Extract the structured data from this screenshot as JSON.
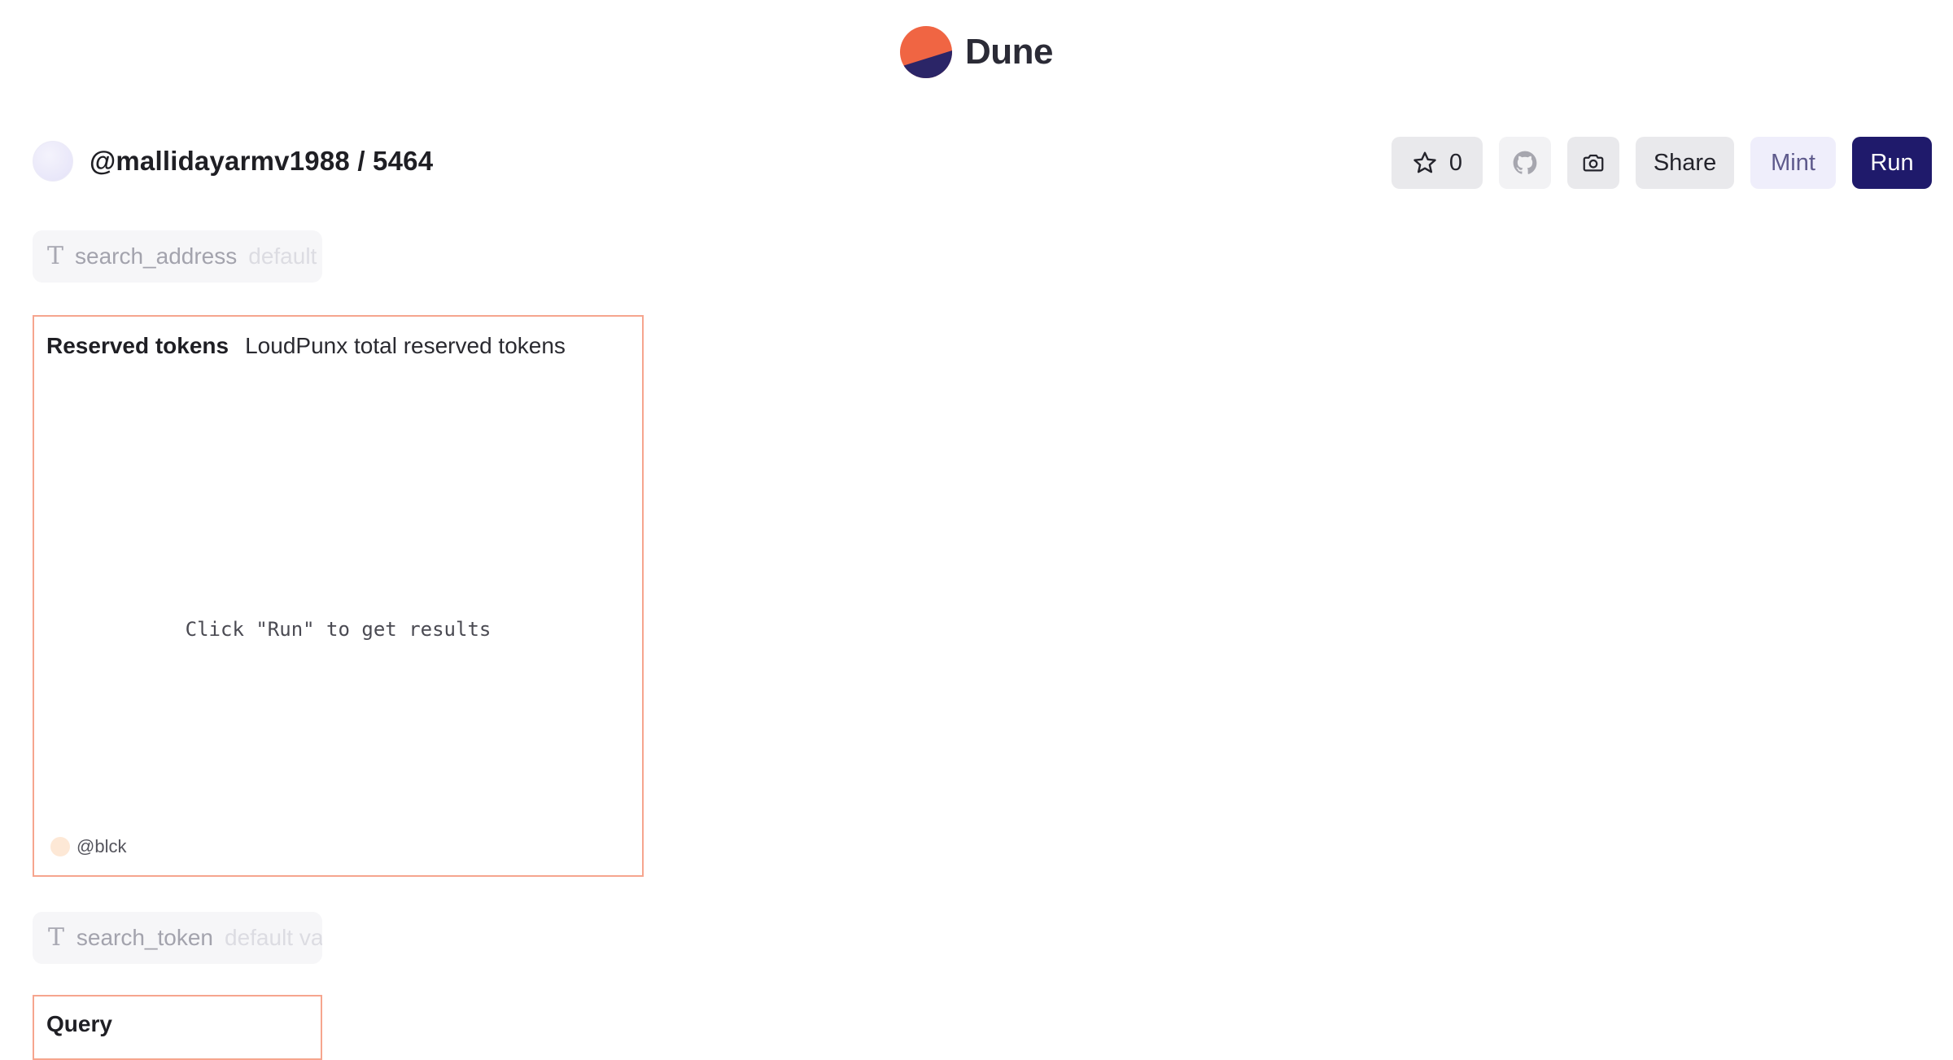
{
  "brand": {
    "name": "Dune",
    "logo_colors": [
      "#f06543",
      "#2b2567"
    ]
  },
  "dashboard": {
    "title": "@mallidayarmv1988 / 5464"
  },
  "actions": {
    "star_count": "0",
    "share_label": "Share",
    "mint_label": "Mint",
    "run_label": "Run",
    "icons": [
      "star-icon",
      "github-icon",
      "camera-icon"
    ]
  },
  "params": [
    {
      "name": "search_address",
      "placeholder": "default value"
    },
    {
      "name": "search_token",
      "placeholder": "default value"
    }
  ],
  "widgets": [
    {
      "title": "Reserved tokens",
      "subtitle": "LoudPunx total reserved tokens",
      "empty_message": "Click \"Run\" to get results",
      "author": "@blck"
    },
    {
      "title": "Query"
    }
  ],
  "colors": {
    "accent": "#1f1a6b",
    "card_border": "#f6a58e",
    "mint_bg": "#efeefb"
  }
}
